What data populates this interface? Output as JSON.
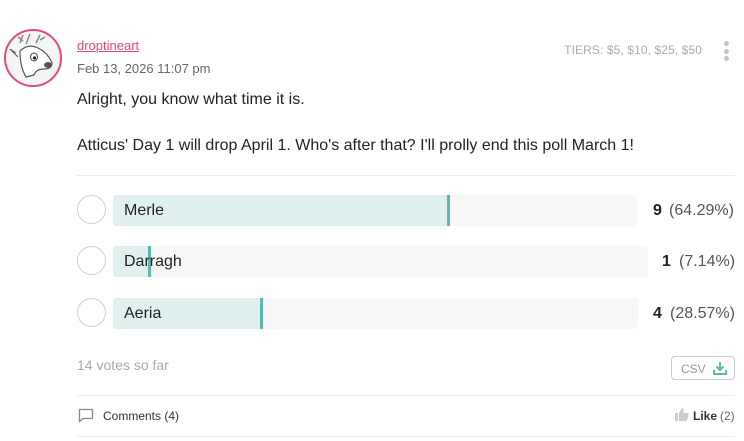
{
  "post": {
    "author": "droptineart",
    "date": "Feb 13, 2026 11:07 pm",
    "tiers": "TIERS:  $5, $10, $25, $50",
    "text_line1": "Alright, you know what time it is.",
    "text_line2": "Atticus' Day 1 will drop April 1. Who's after that? I'll prolly end this poll March 1!"
  },
  "poll": {
    "options": [
      {
        "label": "Merle",
        "votes": "9",
        "percent": "(64.29%)",
        "fraction": 0.6429
      },
      {
        "label": "Darragh",
        "votes": "1",
        "percent": "(7.14%)",
        "fraction": 0.0714
      },
      {
        "label": "Aeria",
        "votes": "4",
        "percent": "(28.57%)",
        "fraction": 0.2857
      }
    ],
    "votes_summary": "14 votes so far",
    "csv_label": "CSV"
  },
  "footer": {
    "comments_label": "Comments (4)",
    "like_label": "Like",
    "like_count": "(2)"
  },
  "colors": {
    "accent": "#e8467c",
    "bar_fill": "#dff0ef",
    "bar_edge": "#5ab8ae"
  },
  "icons": [
    "deer-avatar",
    "kebab-menu-icon",
    "download-icon",
    "comment-icon",
    "thumbs-up-icon"
  ]
}
